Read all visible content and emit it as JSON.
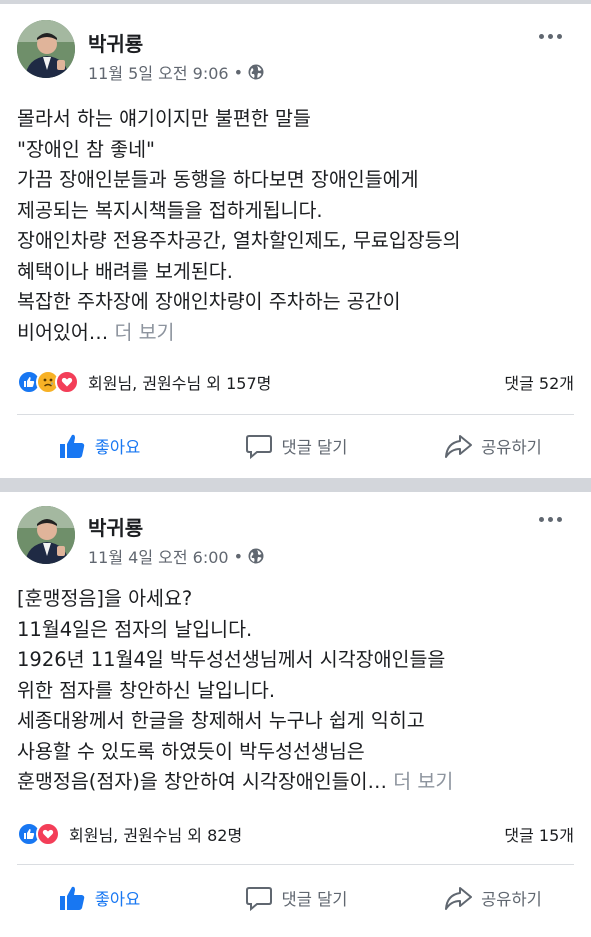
{
  "posts": [
    {
      "author": "박귀룡",
      "timestamp": "11월 5일 오전 9:06",
      "privacy_icon": "globe-icon",
      "lines": [
        "몰라서 하는 얘기이지만 불편한 말들",
        "\"장애인 참 좋네\"",
        "가끔 장애인분들과 동행을 하다보면 장애인들에게",
        "제공되는 복지시책들을 접하게됩니다.",
        "장애인차량 전용주차공간, 열차할인제도, 무료입장등의",
        "혜택이나 배려를 보게된다.",
        "복잡한 주차장에 장애인차량이 주차하는 공간이",
        "비어있어…"
      ],
      "see_more": "더 보기",
      "reactions": "회원님, 권원수님 외 157명",
      "comments": "댓글 52개"
    },
    {
      "author": "박귀룡",
      "timestamp": "11월 4일 오전 6:00",
      "privacy_icon": "globe-icon",
      "lines": [
        "[훈맹정음]을 아세요?",
        "11월4일은 점자의 날입니다.",
        "1926년 11월4일 박두성선생님께서 시각장애인들을",
        "위한 점자를 창안하신 날입니다.",
        "세종대왕께서 한글을 창제해서 누구나 쉽게 익히고",
        "사용할 수 있도록 하였듯이 박두성선생님은",
        "훈맹정음(점자)을 창안하여 시각장애인들이…"
      ],
      "see_more": "더 보기",
      "reactions": "회원님, 권원수님 외 82명",
      "comments": "댓글 15개"
    }
  ],
  "actions": {
    "like": "좋아요",
    "comment": "댓글 달기",
    "share": "공유하기"
  },
  "colors": {
    "like_blue": "#1877f2",
    "love_red": "#f33e58",
    "sad_yellow": "#f7b125",
    "separator": "#d3d6db"
  }
}
